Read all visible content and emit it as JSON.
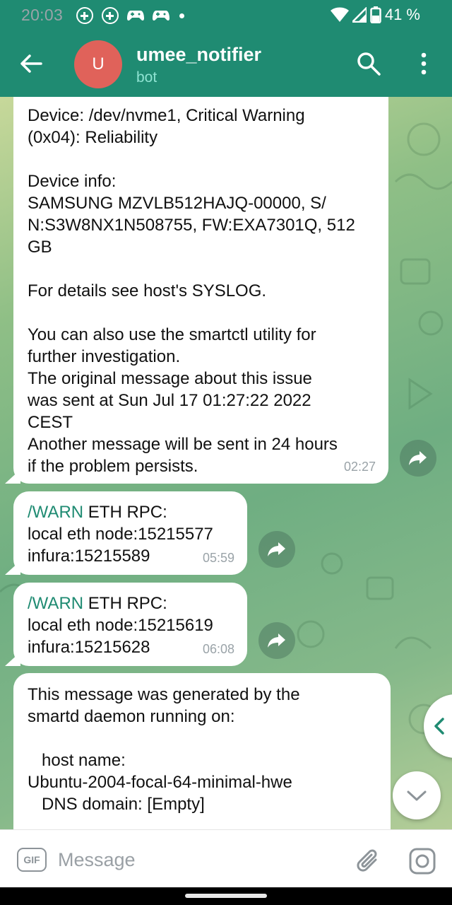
{
  "status_bar": {
    "time": "20:03",
    "battery": "41 %"
  },
  "header": {
    "avatar_letter": "U",
    "title": "umee_notifier",
    "subtitle": "bot"
  },
  "messages": [
    {
      "lines": [
        "Device: /dev/nvme1, Critical Warning",
        "(0x04): Reliability",
        "",
        "Device info:",
        "SAMSUNG MZVLB512HAJQ-00000, S/",
        "N:S3W8NX1N508755, FW:EXA7301Q, 512",
        "GB",
        "",
        "For details see host's SYSLOG.",
        "",
        "You can also use the smartctl utility for",
        "further investigation.",
        "The original message about this issue",
        "was sent at Sun Jul 17 01:27:22 2022",
        "CEST",
        "Another message will be sent in 24 hours",
        "if the problem persists."
      ],
      "time": "02:27"
    },
    {
      "command": "/WARN",
      "line1_rest": " ETH RPC:",
      "line2": "local eth node:15215577",
      "line3": "infura:15215589",
      "time": "05:59"
    },
    {
      "command": "/WARN",
      "line1_rest": " ETH RPC:",
      "line2": "local eth node:15215619",
      "line3": "infura:15215628",
      "time": "06:08"
    },
    {
      "lines": [
        "This message was generated by the",
        "smartd daemon running on:",
        "",
        "   host name:",
        "Ubuntu-2004-focal-64-minimal-hwe",
        "   DNS domain: [Empty]"
      ]
    }
  ],
  "input": {
    "placeholder": "Message",
    "gif_label": "GIF"
  }
}
